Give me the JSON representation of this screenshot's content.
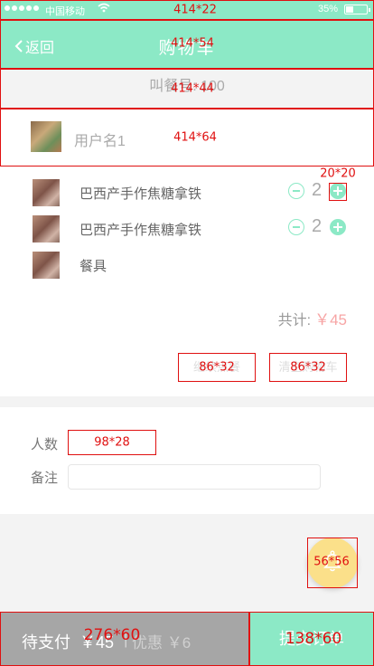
{
  "status_bar": {
    "carrier": "中国移动",
    "battery": "35%"
  },
  "nav": {
    "back_label": "返回",
    "title": "购物车"
  },
  "call_number": "叫餐号: 100",
  "user": {
    "name": "用户名1"
  },
  "items": [
    {
      "name": "巴西产手作焦糖拿铁",
      "qty": "2"
    },
    {
      "name": "巴西产手作焦糖拿铁",
      "qty": "2"
    },
    {
      "name": "餐具"
    }
  ],
  "total": {
    "label": "共计:",
    "amount": "￥45"
  },
  "buttons": {
    "left": "继续点餐",
    "right": "清空购物车"
  },
  "form": {
    "people_label": "人数",
    "note_label": "备注",
    "people_value": "",
    "note_value": ""
  },
  "bottom": {
    "pending_label": "待支付",
    "pending_amount": "￥45",
    "separator": "|",
    "discount": "优惠 ￥6",
    "submit_label": "提交订单"
  },
  "annotations": [
    "414*22",
    "414*54",
    "414*44",
    "414*64",
    "20*20",
    "86*32",
    "86*32",
    "98*28",
    "56*56",
    "276*60",
    "138*60"
  ],
  "colors": {
    "accent": "#8ce9c6",
    "annotation": "#e01010",
    "pending_bg": "#a6a6a6",
    "price": "#f7a5a5",
    "bell": "#fbe08a"
  }
}
